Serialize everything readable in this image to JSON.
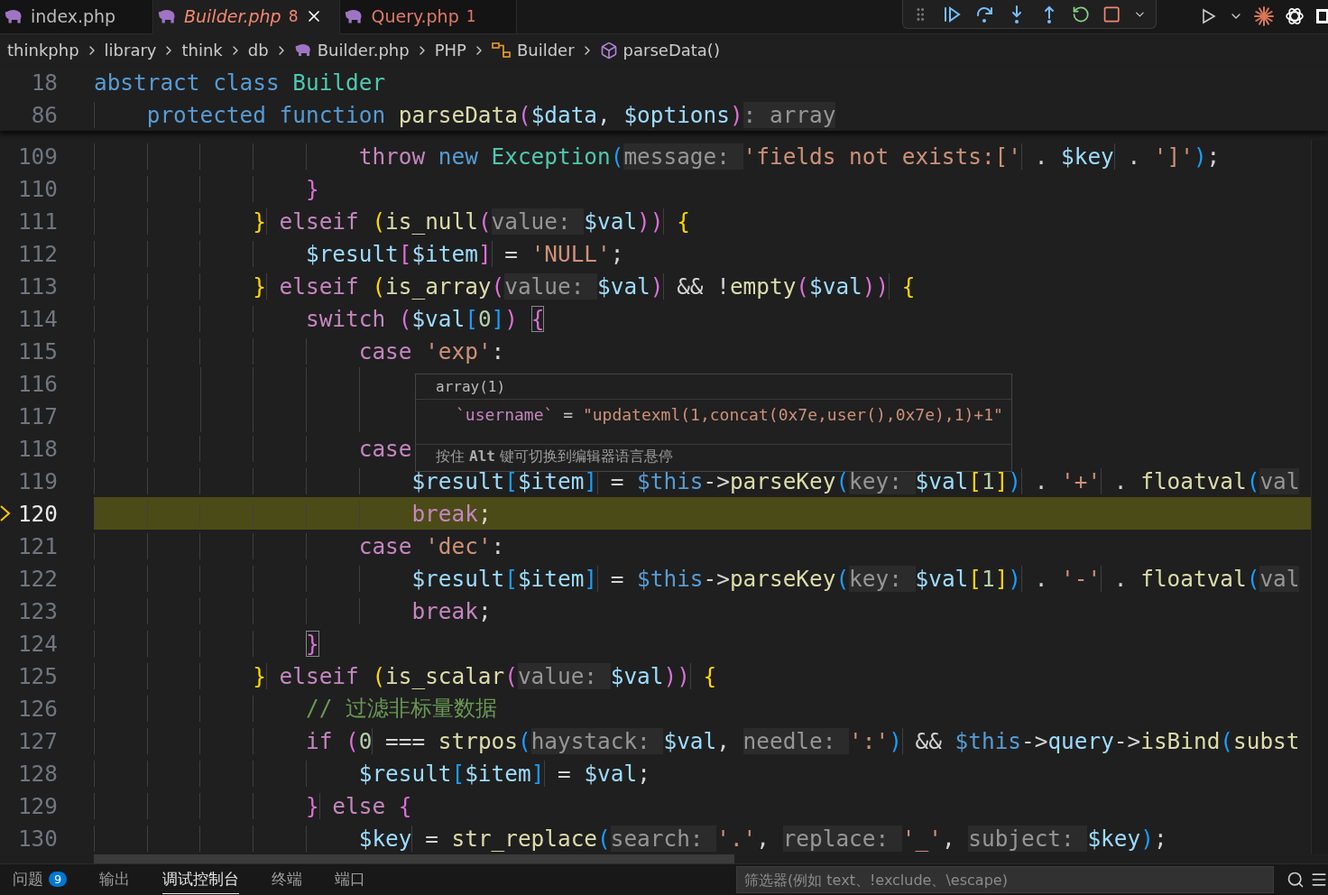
{
  "editor_tabs": [
    {
      "label": "index.php",
      "preview": false,
      "selected": false,
      "closable": false
    },
    {
      "label": "Builder.php",
      "errors": "8",
      "preview": true,
      "selected": true,
      "closable": true
    },
    {
      "label": "Query.php",
      "errors": "1",
      "preview": false,
      "selected": false,
      "closable": false
    }
  ],
  "breadcrumbs": [
    {
      "label": "thinkphp",
      "kind": "folder"
    },
    {
      "label": "library",
      "kind": "folder"
    },
    {
      "label": "think",
      "kind": "folder"
    },
    {
      "label": "db",
      "kind": "folder"
    },
    {
      "label": "Builder.php",
      "kind": "file"
    },
    {
      "label": "PHP",
      "kind": "folder"
    },
    {
      "label": "Builder",
      "kind": "class"
    },
    {
      "label": "parseData()",
      "kind": "method"
    }
  ],
  "sticky_lines": [
    {
      "number": "18",
      "segments": [
        {
          "text": "abstract class ",
          "kind": "storage"
        },
        {
          "text": "Builder",
          "kind": "class"
        }
      ]
    },
    {
      "number": "86",
      "segments": [
        {
          "text": "    protected function ",
          "kind": "storage"
        },
        {
          "text": "parseData",
          "kind": "fn"
        },
        {
          "text": "(",
          "kind": "b2"
        },
        {
          "text": "$data",
          "kind": "var"
        },
        {
          "text": ", ",
          "kind": "p"
        },
        {
          "text": "$options",
          "kind": "var"
        },
        {
          "text": ")",
          "kind": "b2"
        },
        {
          "text": ": array",
          "kind": "hint"
        }
      ]
    }
  ],
  "lines": [
    {
      "number": "109",
      "current": false,
      "segments": [
        {
          "text": "                    throw ",
          "kind": "kw"
        },
        {
          "text": "new ",
          "kind": "storage"
        },
        {
          "text": "Exception",
          "kind": "class"
        },
        {
          "text": "(",
          "kind": "b3"
        },
        {
          "text": "message: ",
          "kind": "hint"
        },
        {
          "text": "'fields not exists:['",
          "kind": "str"
        },
        {
          "text": " . ",
          "kind": "p"
        },
        {
          "text": "$key",
          "kind": "var"
        },
        {
          "text": " . ",
          "kind": "p"
        },
        {
          "text": "']'",
          "kind": "str"
        },
        {
          "text": ")",
          "kind": "b3"
        },
        {
          "text": ";",
          "kind": "p"
        }
      ]
    },
    {
      "number": "110",
      "current": false,
      "segments": [
        {
          "text": "                }",
          "kind": "b2"
        }
      ]
    },
    {
      "number": "111",
      "current": false,
      "segments": [
        {
          "text": "            }",
          "kind": "b1"
        },
        {
          "text": " elseif ",
          "kind": "kw"
        },
        {
          "text": "(",
          "kind": "b1"
        },
        {
          "text": "is_null",
          "kind": "fn"
        },
        {
          "text": "(",
          "kind": "b2"
        },
        {
          "text": "value: ",
          "kind": "hint"
        },
        {
          "text": "$val",
          "kind": "var"
        },
        {
          "text": "))",
          "kind": "b2"
        },
        {
          "text": " {",
          "kind": "b1"
        }
      ]
    },
    {
      "number": "112",
      "current": false,
      "segments": [
        {
          "text": "                $result",
          "kind": "var"
        },
        {
          "text": "[",
          "kind": "b2"
        },
        {
          "text": "$item",
          "kind": "var"
        },
        {
          "text": "]",
          "kind": "b2"
        },
        {
          "text": " = ",
          "kind": "p"
        },
        {
          "text": "'NULL'",
          "kind": "str"
        },
        {
          "text": ";",
          "kind": "p"
        }
      ]
    },
    {
      "number": "113",
      "current": false,
      "segments": [
        {
          "text": "            }",
          "kind": "b1"
        },
        {
          "text": " elseif ",
          "kind": "kw"
        },
        {
          "text": "(",
          "kind": "b1"
        },
        {
          "text": "is_array",
          "kind": "fn"
        },
        {
          "text": "(",
          "kind": "b2"
        },
        {
          "text": "value: ",
          "kind": "hint"
        },
        {
          "text": "$val",
          "kind": "var"
        },
        {
          "text": ")",
          "kind": "b2"
        },
        {
          "text": " && !",
          "kind": "p"
        },
        {
          "text": "empty",
          "kind": "fn"
        },
        {
          "text": "(",
          "kind": "b2"
        },
        {
          "text": "$val",
          "kind": "var"
        },
        {
          "text": "))",
          "kind": "b2"
        },
        {
          "text": " {",
          "kind": "b1"
        }
      ]
    },
    {
      "number": "114",
      "current": false,
      "segments": [
        {
          "text": "                switch ",
          "kind": "kw"
        },
        {
          "text": "(",
          "kind": "b2"
        },
        {
          "text": "$val",
          "kind": "var"
        },
        {
          "text": "[",
          "kind": "b3"
        },
        {
          "text": "0",
          "kind": "num"
        },
        {
          "text": "]",
          "kind": "b3"
        },
        {
          "text": ") ",
          "kind": "b2"
        },
        {
          "text": "{",
          "kind": "match"
        }
      ]
    },
    {
      "number": "115",
      "current": false,
      "segments": [
        {
          "text": "                    case ",
          "kind": "kw"
        },
        {
          "text": "'exp'",
          "kind": "str"
        },
        {
          "text": ":",
          "kind": "p"
        }
      ]
    },
    {
      "number": "116",
      "current": false
    },
    {
      "number": "117",
      "current": false
    },
    {
      "number": "118",
      "current": false,
      "segments": [
        {
          "text": "                    case",
          "kind": "kw"
        }
      ]
    },
    {
      "number": "119",
      "current": false,
      "segments": [
        {
          "text": "                        $result",
          "kind": "var"
        },
        {
          "text": "[",
          "kind": "b3"
        },
        {
          "text": "$item",
          "kind": "var"
        },
        {
          "text": "]",
          "kind": "b3"
        },
        {
          "text": " = ",
          "kind": "p"
        },
        {
          "text": "$this",
          "kind": "storage"
        },
        {
          "text": "->",
          "kind": "p"
        },
        {
          "text": "parseKey",
          "kind": "fn"
        },
        {
          "text": "(",
          "kind": "b3"
        },
        {
          "text": "key: ",
          "kind": "hint"
        },
        {
          "text": "$val",
          "kind": "var"
        },
        {
          "text": "[",
          "kind": "b1"
        },
        {
          "text": "1",
          "kind": "num"
        },
        {
          "text": "]",
          "kind": "b1"
        },
        {
          "text": ")",
          "kind": "b3"
        },
        {
          "text": " . ",
          "kind": "p"
        },
        {
          "text": "'+'",
          "kind": "str"
        },
        {
          "text": " . ",
          "kind": "p"
        },
        {
          "text": "floatval",
          "kind": "fn"
        },
        {
          "text": "(",
          "kind": "b3"
        },
        {
          "text": "val",
          "kind": "hint"
        }
      ]
    },
    {
      "number": "120",
      "current": true,
      "segments": [
        {
          "text": "                        break",
          "kind": "kw"
        },
        {
          "text": ";",
          "kind": "p"
        }
      ]
    },
    {
      "number": "121",
      "current": false,
      "segments": [
        {
          "text": "                    case ",
          "kind": "kw"
        },
        {
          "text": "'dec'",
          "kind": "str"
        },
        {
          "text": ":",
          "kind": "p"
        }
      ]
    },
    {
      "number": "122",
      "current": false,
      "segments": [
        {
          "text": "                        $result",
          "kind": "var"
        },
        {
          "text": "[",
          "kind": "b3"
        },
        {
          "text": "$item",
          "kind": "var"
        },
        {
          "text": "]",
          "kind": "b3"
        },
        {
          "text": " = ",
          "kind": "p"
        },
        {
          "text": "$this",
          "kind": "storage"
        },
        {
          "text": "->",
          "kind": "p"
        },
        {
          "text": "parseKey",
          "kind": "fn"
        },
        {
          "text": "(",
          "kind": "b3"
        },
        {
          "text": "key: ",
          "kind": "hint"
        },
        {
          "text": "$val",
          "kind": "var"
        },
        {
          "text": "[",
          "kind": "b1"
        },
        {
          "text": "1",
          "kind": "num"
        },
        {
          "text": "]",
          "kind": "b1"
        },
        {
          "text": ")",
          "kind": "b3"
        },
        {
          "text": " . ",
          "kind": "p"
        },
        {
          "text": "'-'",
          "kind": "str"
        },
        {
          "text": " . ",
          "kind": "p"
        },
        {
          "text": "floatval",
          "kind": "fn"
        },
        {
          "text": "(",
          "kind": "b3"
        },
        {
          "text": "val",
          "kind": "hint"
        }
      ]
    },
    {
      "number": "123",
      "current": false,
      "segments": [
        {
          "text": "                        break",
          "kind": "kw"
        },
        {
          "text": ";",
          "kind": "p"
        }
      ]
    },
    {
      "number": "124",
      "current": false,
      "segments": [
        {
          "text": "                }",
          "kind": "match"
        }
      ]
    },
    {
      "number": "125",
      "current": false,
      "segments": [
        {
          "text": "            }",
          "kind": "b1"
        },
        {
          "text": " elseif ",
          "kind": "kw"
        },
        {
          "text": "(",
          "kind": "b1"
        },
        {
          "text": "is_scalar",
          "kind": "fn"
        },
        {
          "text": "(",
          "kind": "b2"
        },
        {
          "text": "value: ",
          "kind": "hint"
        },
        {
          "text": "$val",
          "kind": "var"
        },
        {
          "text": "))",
          "kind": "b2"
        },
        {
          "text": " {",
          "kind": "b1"
        }
      ]
    },
    {
      "number": "126",
      "current": false,
      "segments": [
        {
          "text": "                // 过滤非标量数据",
          "kind": "cmt"
        }
      ]
    },
    {
      "number": "127",
      "current": false,
      "segments": [
        {
          "text": "                if ",
          "kind": "kw"
        },
        {
          "text": "(",
          "kind": "b2"
        },
        {
          "text": "0",
          "kind": "num"
        },
        {
          "text": " === ",
          "kind": "p"
        },
        {
          "text": "strpos",
          "kind": "fn"
        },
        {
          "text": "(",
          "kind": "b3"
        },
        {
          "text": "haystack: ",
          "kind": "hint"
        },
        {
          "text": "$val",
          "kind": "var"
        },
        {
          "text": ", ",
          "kind": "p"
        },
        {
          "text": "needle: ",
          "kind": "hint"
        },
        {
          "text": "':'",
          "kind": "str"
        },
        {
          "text": ")",
          "kind": "b3"
        },
        {
          "text": " && ",
          "kind": "p"
        },
        {
          "text": "$this",
          "kind": "storage"
        },
        {
          "text": "->",
          "kind": "p"
        },
        {
          "text": "query",
          "kind": "var"
        },
        {
          "text": "->",
          "kind": "p"
        },
        {
          "text": "isBind",
          "kind": "fn"
        },
        {
          "text": "(",
          "kind": "b3"
        },
        {
          "text": "subst",
          "kind": "fn"
        }
      ]
    },
    {
      "number": "128",
      "current": false,
      "segments": [
        {
          "text": "                    $result",
          "kind": "var"
        },
        {
          "text": "[",
          "kind": "b3"
        },
        {
          "text": "$item",
          "kind": "var"
        },
        {
          "text": "]",
          "kind": "b3"
        },
        {
          "text": " = ",
          "kind": "p"
        },
        {
          "text": "$val",
          "kind": "var"
        },
        {
          "text": ";",
          "kind": "p"
        }
      ]
    },
    {
      "number": "129",
      "current": false,
      "segments": [
        {
          "text": "                }",
          "kind": "b2"
        },
        {
          "text": " else ",
          "kind": "kw"
        },
        {
          "text": "{",
          "kind": "b2"
        }
      ]
    },
    {
      "number": "130",
      "current": false,
      "segments": [
        {
          "text": "                    $key",
          "kind": "var"
        },
        {
          "text": " = ",
          "kind": "p"
        },
        {
          "text": "str_replace",
          "kind": "fn"
        },
        {
          "text": "(",
          "kind": "b3"
        },
        {
          "text": "search: ",
          "kind": "hint"
        },
        {
          "text": "'.'",
          "kind": "str"
        },
        {
          "text": ", ",
          "kind": "p"
        },
        {
          "text": "replace: ",
          "kind": "hint"
        },
        {
          "text": "'_'",
          "kind": "str"
        },
        {
          "text": ", ",
          "kind": "p"
        },
        {
          "text": "subject: ",
          "kind": "hint"
        },
        {
          "text": "$key",
          "kind": "var"
        },
        {
          "text": ")",
          "kind": "b3"
        },
        {
          "text": ";",
          "kind": "p"
        }
      ]
    }
  ],
  "hover": {
    "type_line": "array(1)",
    "key": "`username`",
    "equals": " = ",
    "value": "\"updatexml(1,concat(0x7e,user(),0x7e),1)+1\"",
    "footer": "按住 **Alt** 键可切换到编辑器语言悬停"
  },
  "panel": {
    "tabs": [
      {
        "label": "问题",
        "badge": "9",
        "selected": false
      },
      {
        "label": "输出",
        "selected": false
      },
      {
        "label": "调试控制台",
        "selected": true
      },
      {
        "label": "终端",
        "selected": false
      },
      {
        "label": "端口",
        "selected": false
      }
    ],
    "filter": {
      "placeholder": "筛选器(例如 text、!exclude、\\escape)"
    }
  }
}
